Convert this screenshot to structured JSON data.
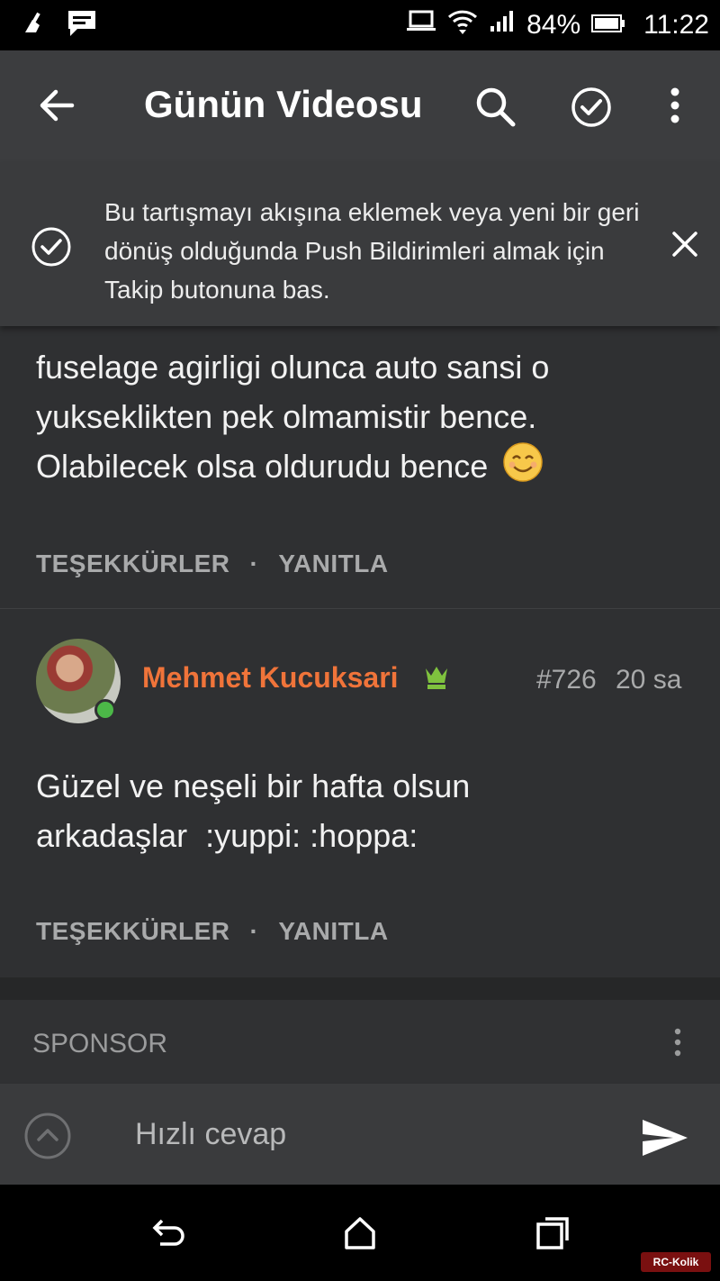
{
  "status_bar": {
    "battery_percent": "84%",
    "time": "11:22"
  },
  "app_bar": {
    "title": "Günün Videosu"
  },
  "follow_banner": {
    "message": "Bu tartışmayı akışına eklemek veya yeni bir geri dönüş olduğunda Push Bildirimleri almak için Takip butonuna bas."
  },
  "posts": [
    {
      "lines": [
        "fuselage agirligi olunca auto sansi o",
        "yukseklikten pek olmamistir bence.",
        "Olabilecek olsa oldurudu bence"
      ],
      "emoji": "😊",
      "actions": {
        "thanks": "TEŞEKKÜRLER",
        "separator": "·",
        "reply": "YANITLA"
      }
    },
    {
      "username": "Mehmet Kucuksari",
      "number": "#726",
      "time": "20 sa",
      "lines": [
        "Güzel ve neşeli bir hafta olsun",
        "arkadaşlar  :yuppi: :hoppa:"
      ],
      "actions": {
        "thanks": "TEŞEKKÜRLER",
        "separator": "·",
        "reply": "YANITLA"
      }
    }
  ],
  "sponsor": {
    "label": "SPONSOR"
  },
  "quick_reply": {
    "placeholder": "Hızlı cevap"
  },
  "watermark": "RC-Kolik",
  "colors": {
    "username": "#f0743a",
    "online": "#4cb848",
    "background": "#2f3032",
    "appbar": "#3c3d3f"
  }
}
